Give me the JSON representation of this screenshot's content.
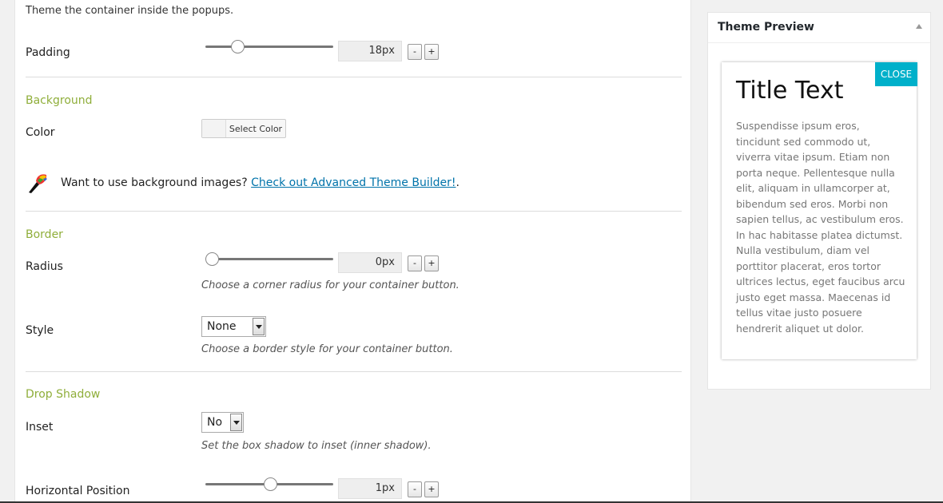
{
  "intro_text": "Theme the container inside the popups.",
  "padding": {
    "label": "Padding",
    "value": "18px",
    "slider_fraction": 0.22,
    "minus": "-",
    "plus": "+"
  },
  "background": {
    "section_title": "Background",
    "color_label": "Color",
    "color_button": "Select Color"
  },
  "promo": {
    "text": "Want to use background images? ",
    "link": "Check out Advanced Theme Builder!",
    "suffix": ".",
    "icon": "paintbrush-icon"
  },
  "border": {
    "section_title": "Border",
    "radius_label": "Radius",
    "radius_value": "0px",
    "radius_slider_fraction": 0.0,
    "radius_hint": "Choose a corner radius for your container button.",
    "style_label": "Style",
    "style_value": "None",
    "style_hint": "Choose a border style for your container button.",
    "minus": "-",
    "plus": "+"
  },
  "drop_shadow": {
    "section_title": "Drop Shadow",
    "inset_label": "Inset",
    "inset_value": "No",
    "inset_hint": "Set the box shadow to inset (inner shadow).",
    "hpos_label": "Horizontal Position",
    "hpos_value": "1px",
    "hpos_slider_fraction": 0.51,
    "minus": "-",
    "plus": "+"
  },
  "preview": {
    "header": "Theme Preview",
    "popup_title": "Title Text",
    "popup_body": "Suspendisse ipsum eros, tincidunt sed commodo ut, viverra vitae ipsum. Etiam non porta neque. Pellentesque nulla elit, aliquam in ullamcorper at, bibendum sed eros. Morbi non sapien tellus, ac vestibulum eros. In hac habitasse platea dictumst. Nulla vestibulum, diam vel porttitor placerat, eros tortor ultrices lectus, eget faucibus arcu justo eget massa. Maecenas id tellus vitae justo posuere hendrerit aliquet ut dolor.",
    "close_label": "CLOSE",
    "close_color": "#00b0ca"
  },
  "colors": {
    "section_green": "#8fae3a",
    "link_blue": "#0073aa"
  }
}
